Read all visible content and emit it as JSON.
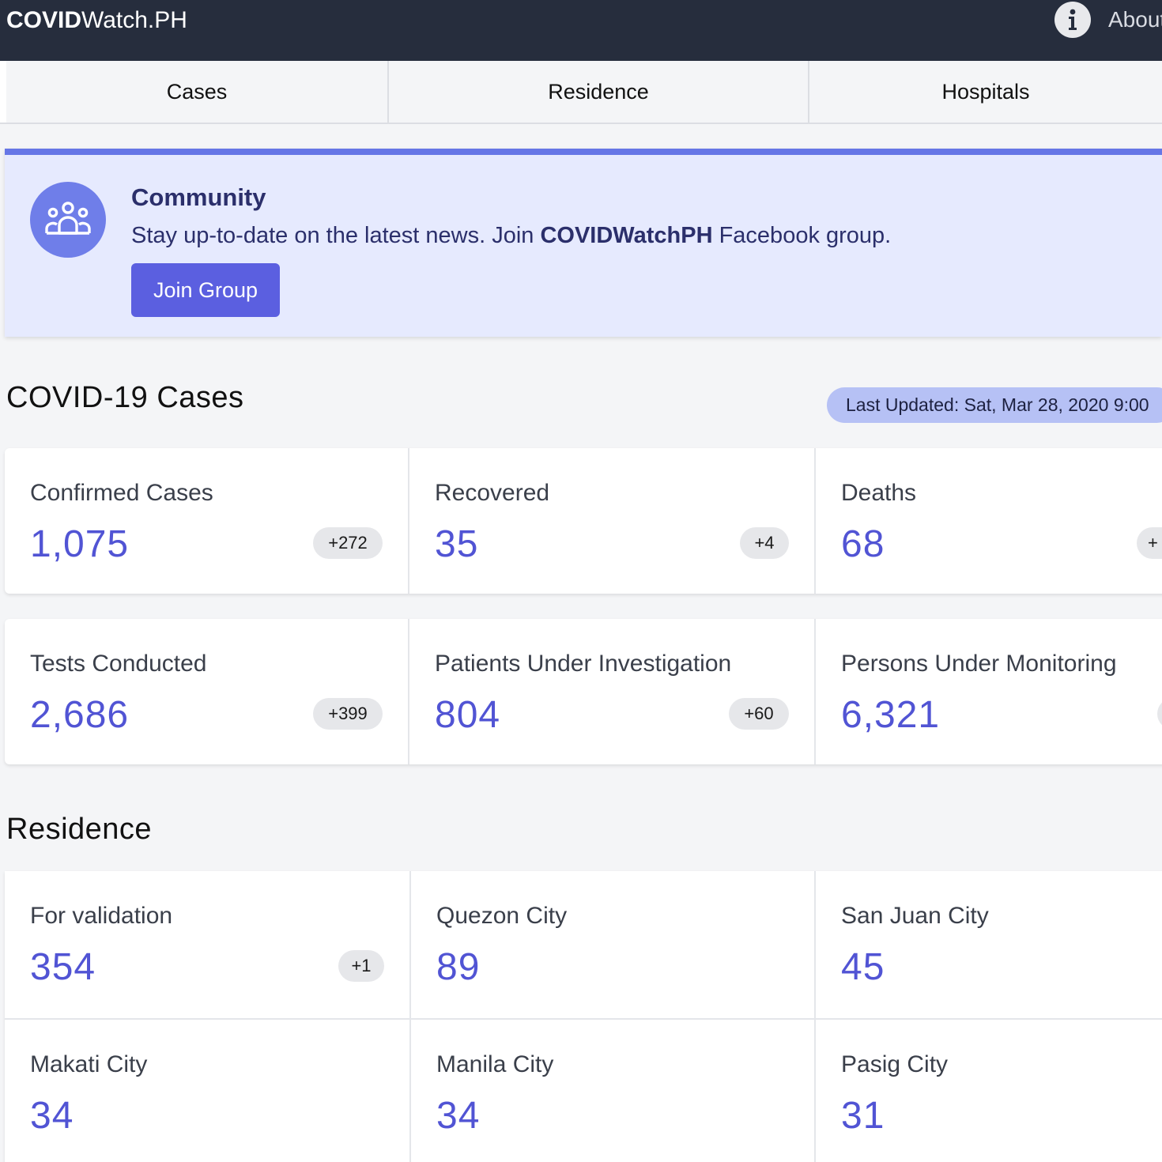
{
  "header": {
    "brand_bold": "COVID",
    "brand_rest": "Watch.PH",
    "about_label": "About",
    "icons": {
      "about": "info-icon"
    }
  },
  "tabs": [
    {
      "label": "Cases"
    },
    {
      "label": "Residence"
    },
    {
      "label": "Hospitals"
    }
  ],
  "banner": {
    "icon": "community-icon",
    "title": "Community",
    "desc_before": "Stay up-to-date on the latest news. Join ",
    "desc_bold": "COVIDWatchPH",
    "desc_after": " Facebook group.",
    "button_label": "Join Group"
  },
  "cases": {
    "title": "COVID-19 Cases",
    "last_updated": "Last Updated: Sat, Mar 28, 2020 9:00",
    "cards": [
      {
        "label": "Confirmed Cases",
        "value": "1,075",
        "delta": "+272"
      },
      {
        "label": "Recovered",
        "value": "35",
        "delta": "+4"
      },
      {
        "label": "Deaths",
        "value": "68",
        "delta": "+"
      },
      {
        "label": "Tests Conducted",
        "value": "2,686",
        "delta": "+399"
      },
      {
        "label": "Patients Under Investigation",
        "value": "804",
        "delta": "+60"
      },
      {
        "label": "Persons Under Monitoring",
        "value": "6,321",
        "delta": ""
      }
    ]
  },
  "residence": {
    "title": "Residence",
    "cards": [
      {
        "label": "For validation",
        "value": "354",
        "delta": "+1"
      },
      {
        "label": "Quezon City",
        "value": "89"
      },
      {
        "label": "San Juan City",
        "value": "45"
      },
      {
        "label": "Makati City",
        "value": "34"
      },
      {
        "label": "Manila City",
        "value": "34"
      },
      {
        "label": "Pasig City",
        "value": "31"
      }
    ]
  },
  "colors": {
    "header_bg": "#262d3d",
    "accent": "#5b5fe0",
    "value_text": "#5154d4",
    "banner_bg": "#e6eafe",
    "badge_bg": "#b6c1f5"
  }
}
